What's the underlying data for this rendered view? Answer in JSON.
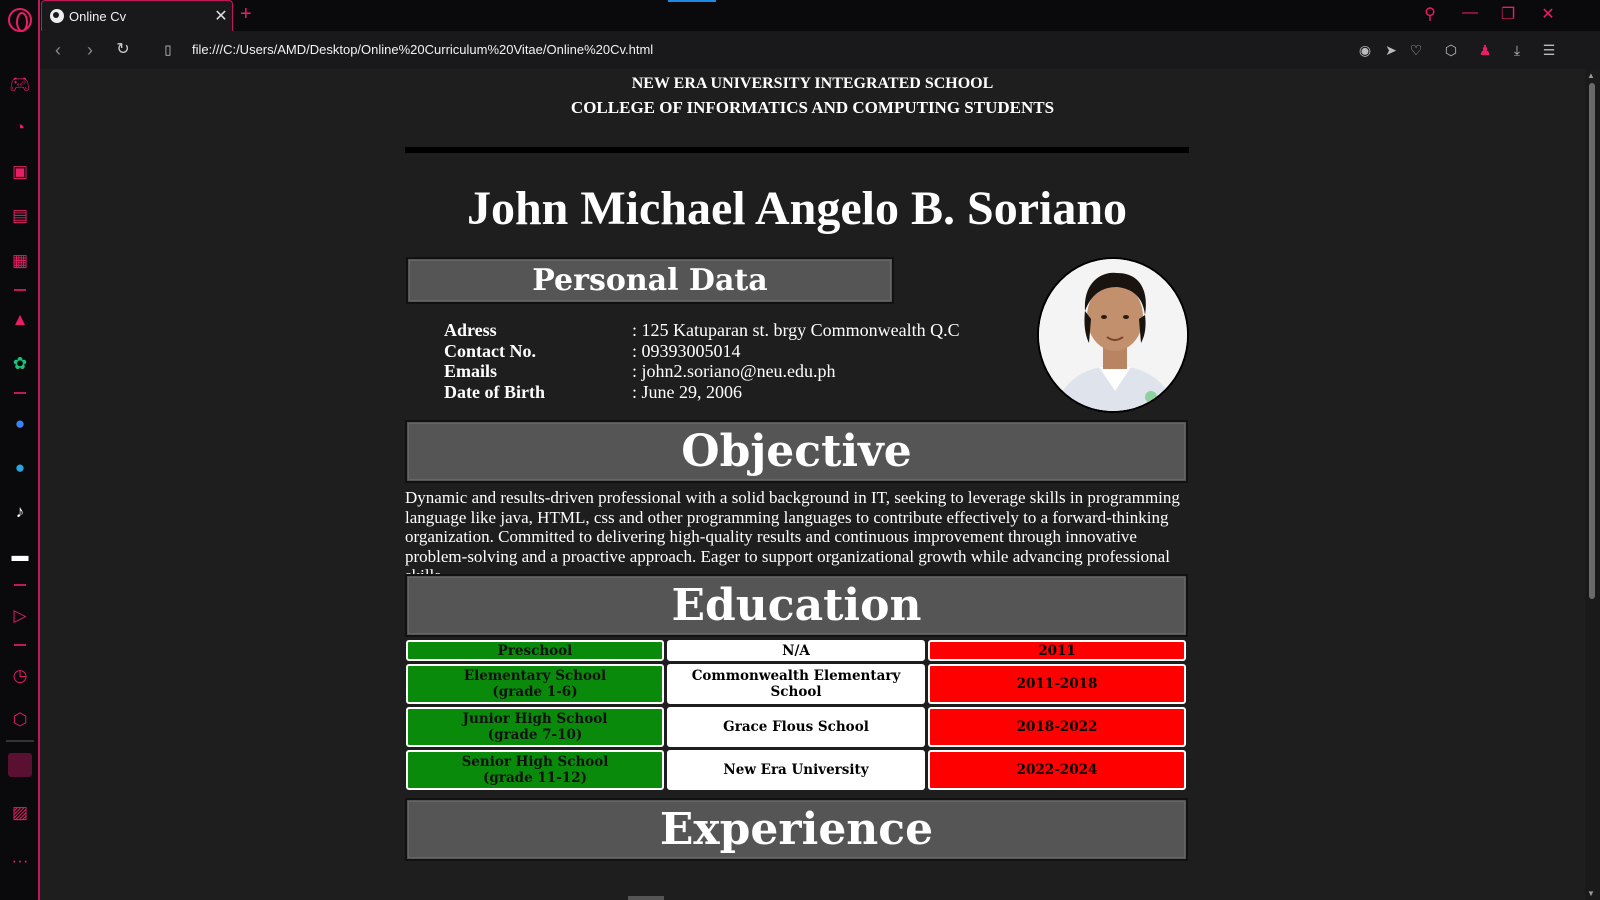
{
  "browser": {
    "tab_title": "Online Cv",
    "tab_close": "✕",
    "new_tab": "+",
    "url": "file:///C:/Users/AMD/Desktop/Online%20Curriculum%20Vitae/Online%20Cv.html",
    "accent_color": "#e91e63",
    "sidebar_icons": [
      "opera-logo-icon",
      "gamepad-icon",
      "speed-dial-icon",
      "shopping-bag-icon",
      "twitch-icon",
      "cpu-icon",
      "aria-icon",
      "chatgpt-icon",
      "messenger-icon",
      "telegram-icon",
      "tiktok-icon",
      "discord-icon",
      "player-icon",
      "history-icon",
      "extensions-icon",
      "workspace-icon",
      "gallery-icon",
      "more-icon"
    ]
  },
  "cv": {
    "school_line_1": "NEW ERA UNIVERSITY INTEGRATED SCHOOL",
    "school_line_2": "COLLEGE OF INFORMATICS AND COMPUTING STUDENTS",
    "name": "John Michael Angelo B. Soriano",
    "personal_data_title": "Personal Data",
    "personal_data": [
      {
        "label": "Adress",
        "value": ": 125 Katuparan st. brgy Commonwealth Q.C"
      },
      {
        "label": "Contact No.",
        "value": ": 09393005014"
      },
      {
        "label": "Emails",
        "value": ": john2.soriano@neu.edu.ph"
      },
      {
        "label": "Date of Birth",
        "value": ": June 29, 2006"
      }
    ],
    "objective_title": "Objective",
    "objective_text": "Dynamic and results-driven professional with a solid background in IT, seeking to leverage skills in programming language like java, HTML, css and other programming languages to contribute effectively to a forward-thinking organization. Committed to delivering high-quality results and continuous improvement through innovative problem-solving and a proactive approach. Eager to support organizational growth while advancing professional skills.",
    "education_title": "Education",
    "education": [
      {
        "level": "Preschool",
        "school": "N/A",
        "years": "2011"
      },
      {
        "level": "Elementary School\n(grade 1-6)",
        "school": "Commonwealth Elementary School",
        "years": "2011-2018"
      },
      {
        "level": "Junior High School\n(grade 7-10)",
        "school": "Grace Flous School",
        "years": "2018-2022"
      },
      {
        "level": "Senior High School\n(grade 11-12)",
        "school": "New Era University",
        "years": "2022-2024"
      }
    ],
    "experience_title": "Experience",
    "colors": {
      "level": "#0a8a0a",
      "school": "#ffffff",
      "years": "#ff0000",
      "section_box": "#555555"
    }
  }
}
